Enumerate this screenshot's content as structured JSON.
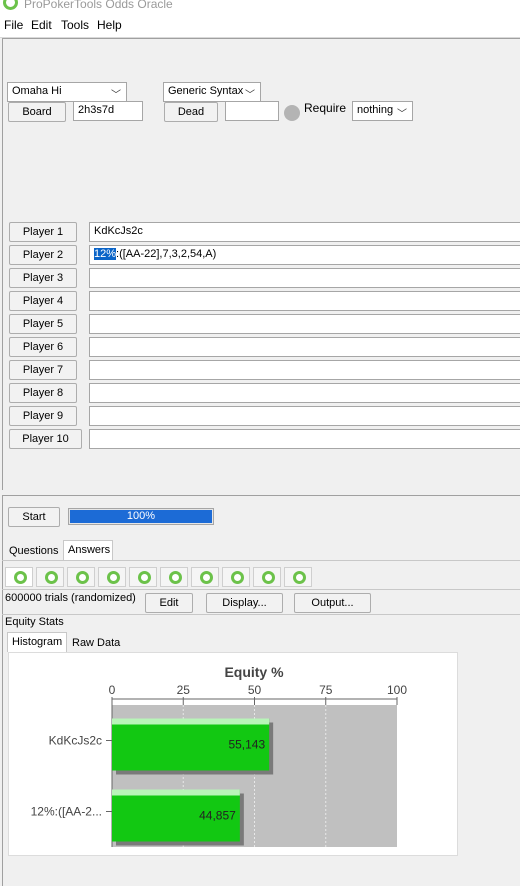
{
  "window": {
    "title": "ProPokerTools Odds Oracle"
  },
  "menu": {
    "file": "File",
    "edit": "Edit",
    "tools": "Tools",
    "help": "Help"
  },
  "setup": {
    "game": "Omaha Hi",
    "syntax": "Generic Syntax",
    "board_button": "Board",
    "board_value": "2h3s7d",
    "dead_button": "Dead",
    "dead_value": "",
    "require_label": "Require",
    "require_value": "nothing"
  },
  "players": [
    {
      "label": "Player 1",
      "value": "KdKcJs2c"
    },
    {
      "label": "Player 2",
      "value_selected": "12%",
      "value_rest": ":([AA-22],7,3,2,54,A)"
    },
    {
      "label": "Player 3",
      "value": ""
    },
    {
      "label": "Player 4",
      "value": ""
    },
    {
      "label": "Player 5",
      "value": ""
    },
    {
      "label": "Player 6",
      "value": ""
    },
    {
      "label": "Player 7",
      "value": ""
    },
    {
      "label": "Player 8",
      "value": ""
    },
    {
      "label": "Player 9",
      "value": ""
    },
    {
      "label": "Player 10",
      "value": ""
    }
  ],
  "run": {
    "start_button": "Start",
    "progress_text": "100%",
    "progress": 1.0
  },
  "tabs": {
    "questions": "Questions",
    "answers": "Answers"
  },
  "answer_icons": [
    "spade-icon",
    "spade-icon",
    "spade-icon",
    "spade-icon",
    "spade-icon",
    "spade-icon",
    "spade-icon",
    "spade-icon",
    "spade-icon",
    "spade-icon"
  ],
  "results": {
    "trials": "600000 trials (randomized)",
    "edit_button": "Edit",
    "display_button": "Display...",
    "output_button": "Output...",
    "section_label": "Equity Stats",
    "subtab_histogram": "Histogram",
    "subtab_raw": "Raw Data"
  },
  "colors": {
    "bar": "#12c812",
    "bar_track": "#c0c0c0",
    "accent": "#6cc24a",
    "progress": "#1c6bd6"
  },
  "chart_data": {
    "type": "bar",
    "orientation": "horizontal",
    "title": "Equity %",
    "categories": [
      "KdKcJs2c",
      "12%:([AA-2..."
    ],
    "values": [
      55.143,
      44.857
    ],
    "value_labels": [
      "55,143",
      "44,857"
    ],
    "xlim": [
      0,
      100
    ],
    "xticks": [
      "0",
      "25",
      "50",
      "75",
      "100"
    ],
    "grid": true
  }
}
